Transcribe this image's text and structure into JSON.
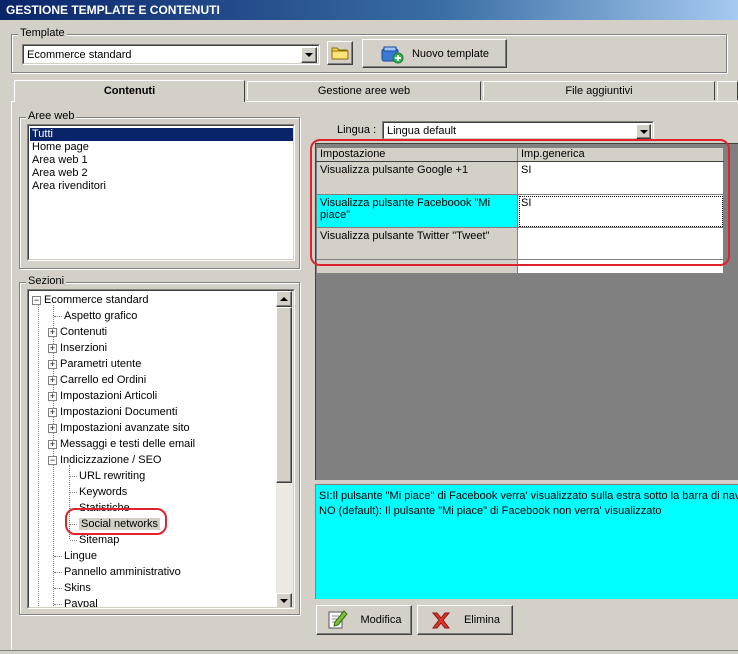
{
  "window": {
    "title": "GESTIONE TEMPLATE E CONTENUTI"
  },
  "template_group": {
    "legend": "Template",
    "selected": "Ecommerce standard",
    "new_template_label": "Nuovo template"
  },
  "tabs": [
    {
      "label": "Contenuti",
      "active": true
    },
    {
      "label": "Gestione aree web",
      "active": false
    },
    {
      "label": "File aggiuntivi",
      "active": false
    }
  ],
  "aree_web": {
    "legend": "Aree web",
    "items": [
      "Tutti",
      "Home page",
      "Area web 1",
      "Area web 2",
      "Area rivenditori"
    ],
    "selected_index": 0
  },
  "sezioni": {
    "legend": "Sezioni",
    "root": "Ecommerce standard",
    "items": [
      {
        "label": "Aspetto grafico",
        "expander": false
      },
      {
        "label": "Contenuti",
        "expander": true
      },
      {
        "label": "Inserzioni",
        "expander": true
      },
      {
        "label": "Parametri utente",
        "expander": true
      },
      {
        "label": "Carrello ed Ordini",
        "expander": true
      },
      {
        "label": "Impostazioni Articoli",
        "expander": true
      },
      {
        "label": "Impostazioni Documenti",
        "expander": true
      },
      {
        "label": "Impostazioni avanzate sito",
        "expander": true
      },
      {
        "label": "Messaggi e testi delle email",
        "expander": true
      },
      {
        "label": "Indicizzazione / SEO",
        "expander": true,
        "expanded": true
      }
    ],
    "seo_children": [
      "URL rewriting",
      "Keywords",
      "Statistiche",
      "Social networks",
      "Sitemap"
    ],
    "seo_selected_index": 3,
    "after_items": [
      "Lingue",
      "Pannello amministrativo",
      "Skins",
      "Paypal"
    ]
  },
  "lingua": {
    "label": "Lingua :",
    "selected": "Lingua default"
  },
  "grid": {
    "headers": [
      "Impostazione",
      "Imp.generica"
    ],
    "rows": [
      {
        "setting": "Visualizza pulsante Google +1",
        "value": "SI",
        "selected": false
      },
      {
        "setting": "Visualizza pulsante Faceboook \"Mi piace\"",
        "value": "SI",
        "selected": true
      },
      {
        "setting": "Visualizza pulsante Twitter \"Tweet\"",
        "value": "",
        "selected": false
      }
    ]
  },
  "description": {
    "line1": "SI:Il pulsante \"Mi piace\" di Facebook verra' visualizzato sulla estra sotto la barra di navig",
    "line2": "NO (default): Il pulsante \"Mi piace\" di Facebook non verra' visualizzato"
  },
  "buttons": {
    "modifica": "Modifica",
    "elimina": "Elimina"
  },
  "colors": {
    "highlight_cyan": "#00ffff",
    "annotation_red": "#e0222c",
    "selection_blue": "#0a246a"
  }
}
